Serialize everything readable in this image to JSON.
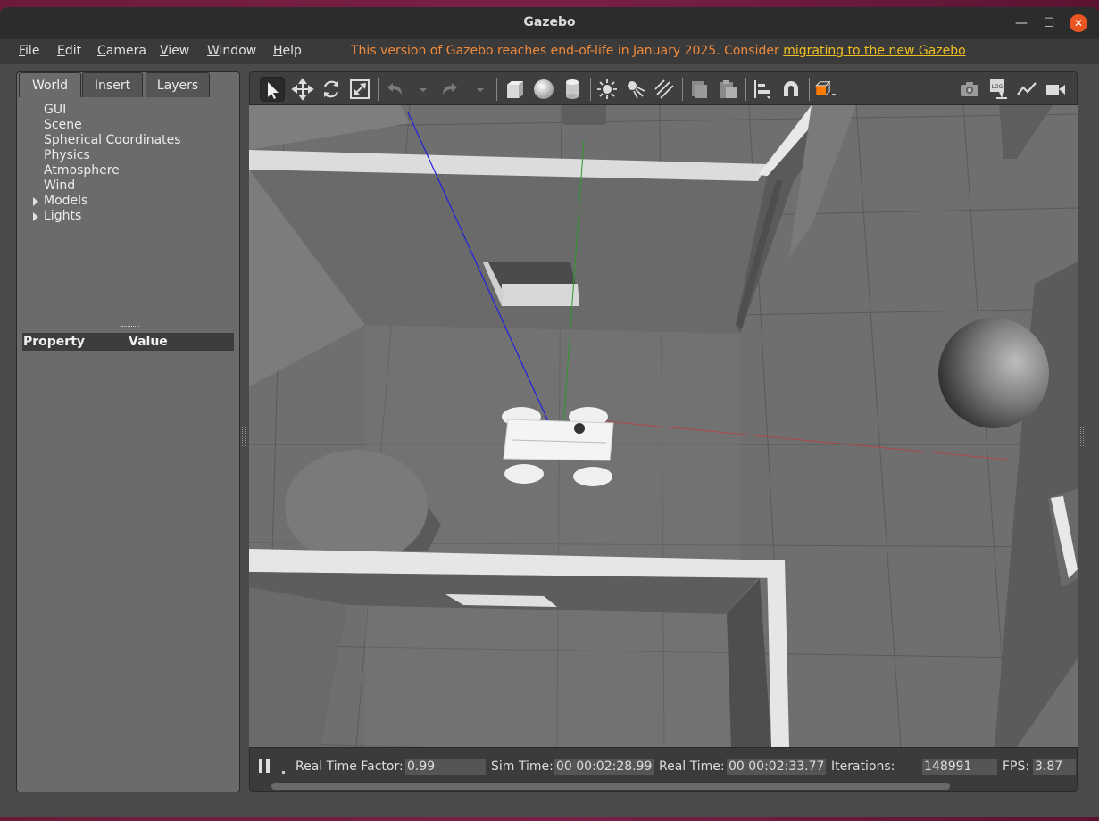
{
  "window": {
    "title": "Gazebo"
  },
  "menu": {
    "items": [
      {
        "label": "File",
        "mnemonic": "F",
        "rest": "ile"
      },
      {
        "label": "Edit",
        "mnemonic": "E",
        "rest": "dit"
      },
      {
        "label": "Camera",
        "mnemonic": "C",
        "rest": "amera"
      },
      {
        "label": "View",
        "mnemonic": "V",
        "rest": "iew"
      },
      {
        "label": "Window",
        "mnemonic": "W",
        "rest": "indow"
      },
      {
        "label": "Help",
        "mnemonic": "H",
        "rest": "elp"
      }
    ],
    "notice_text": "This version of Gazebo reaches end-of-life in January 2025. Consider ",
    "notice_link": "migrating to the new Gazebo"
  },
  "left_panel": {
    "tabs": [
      "World",
      "Insert",
      "Layers"
    ],
    "active_tab": "World",
    "tree": [
      "GUI",
      "Scene",
      "Spherical Coordinates",
      "Physics",
      "Atmosphere",
      "Wind",
      "Models",
      "Lights"
    ],
    "property_header": {
      "property": "Property",
      "value": "Value"
    }
  },
  "toolbar": {
    "icons": [
      "select-arrow",
      "translate",
      "rotate",
      "scale",
      "undo",
      "undo-history",
      "redo",
      "redo-history",
      "box",
      "sphere",
      "cylinder",
      "point-light",
      "spot-light",
      "directional-light",
      "copy",
      "paste",
      "align",
      "snap-magnet",
      "view-angle",
      "screenshot",
      "log",
      "plot",
      "record-video"
    ]
  },
  "status": {
    "real_time_factor_label": "Real Time Factor:",
    "real_time_factor": "0.99",
    "sim_time_label": "Sim Time:",
    "sim_time": "00 00:02:28.991",
    "real_time_label": "Real Time:",
    "real_time": "00 00:02:33.771",
    "iterations_label": "Iterations:",
    "iterations": "148991",
    "fps_label": "FPS:",
    "fps": "3.87"
  },
  "colors": {
    "notice": "#f08a3c",
    "link": "#f0c020",
    "close_button": "#e95420",
    "view_angle_cube": "#ff7a00"
  }
}
